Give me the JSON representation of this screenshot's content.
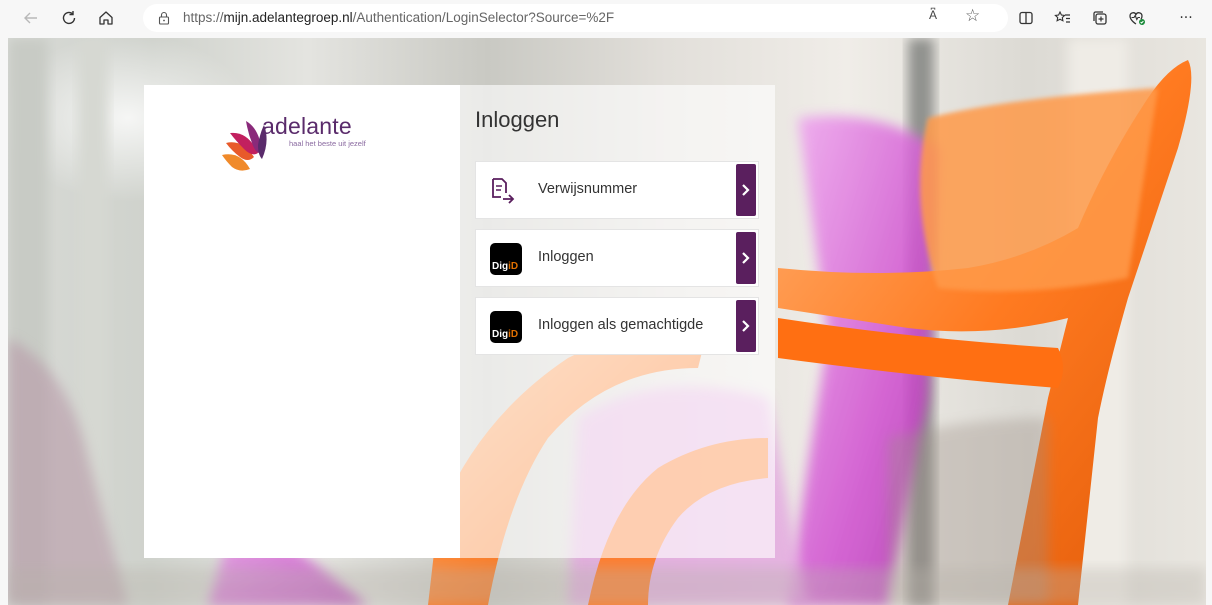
{
  "browser": {
    "url_prefix": "https://",
    "url_host": "mijn.adelantegroep.nl",
    "url_path": "/Authentication/LoginSelector?Source=%2F",
    "read_aloud": "A͆"
  },
  "logo": {
    "name": "adelante",
    "tagline": "haal het beste uit jezelf"
  },
  "login": {
    "title": "Inloggen",
    "options": [
      {
        "label": "Verwijsnummer",
        "icon": "document-arrow-icon"
      },
      {
        "label": "Inloggen",
        "icon": "digid-logo",
        "logo_text_a": "Dig",
        "logo_text_b": "iD"
      },
      {
        "label": "Inloggen als gemachtigde",
        "icon": "digid-logo",
        "logo_text_a": "Dig",
        "logo_text_b": "iD"
      }
    ]
  },
  "colors": {
    "brand_purple": "#5a1f5e",
    "digid_orange": "#e17000"
  }
}
